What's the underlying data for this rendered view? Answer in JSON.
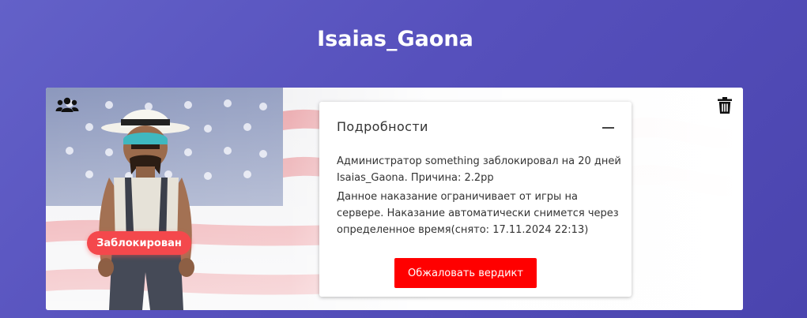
{
  "header": {
    "player_name": "Isaias_Gaona"
  },
  "card": {
    "status_badge": "Заблокирован",
    "icons": {
      "top_left": "group-icon",
      "top_right": "trash-icon",
      "collapse": "minus-icon"
    }
  },
  "details": {
    "title": "Подробности",
    "line1": "Администратор something заблокировал на 20 дней Isaias_Gaona. Причина: 2.2pp",
    "line2": "Данное наказание ограничивает от игры на сервере. Наказание автоматически снимется через определенное время(снято: 17.11.2024 22:13)",
    "appeal_button": "Обжаловать вердикт"
  },
  "colors": {
    "background": "#5650bc",
    "badge": "#f4484c",
    "button": "#ff0000"
  }
}
